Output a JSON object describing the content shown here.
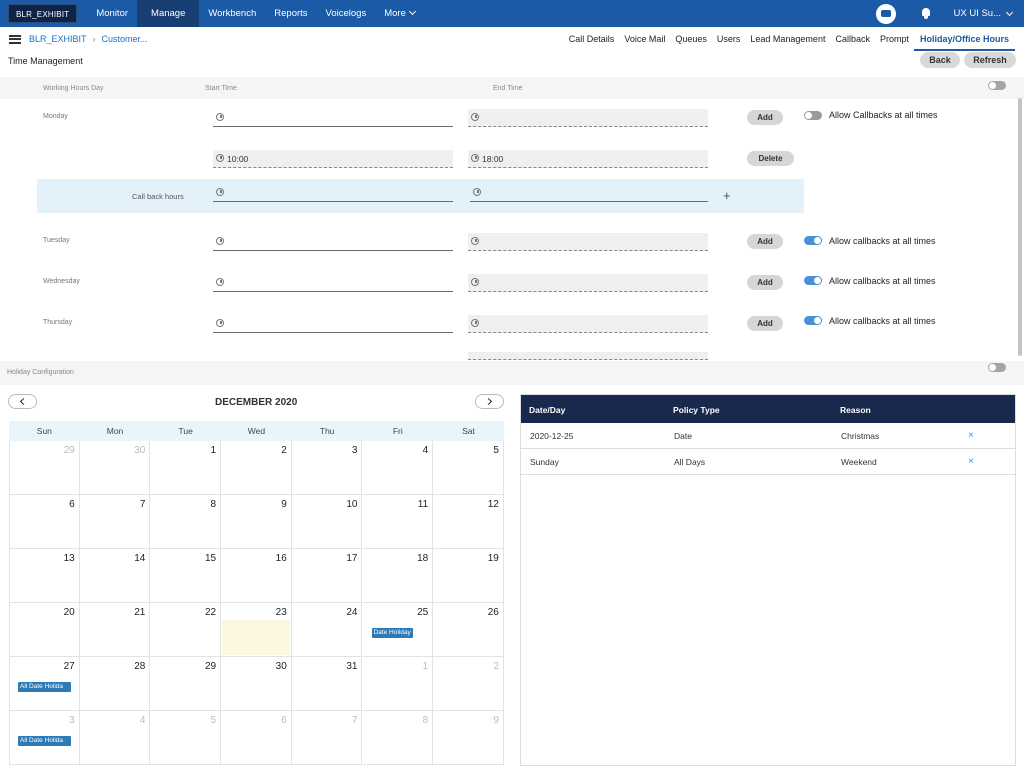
{
  "topnav": {
    "brand": "BLR_EXHIBIT",
    "items": [
      "Monitor",
      "Manage",
      "Workbench",
      "Reports",
      "Voicelogs",
      "More"
    ],
    "active": "Manage",
    "user": "UX UI Su...",
    "icons": [
      "chat-icon",
      "bell-icon",
      "chevron-down-icon"
    ]
  },
  "subnav": {
    "breadcrumb": [
      "BLR_EXHIBIT",
      "Customer..."
    ],
    "tabs": [
      "Call Details",
      "Voice Mail",
      "Queues",
      "Users",
      "Lead Management",
      "Callback",
      "Prompt",
      "Holiday/Office Hours"
    ],
    "active_tab": "Holiday/Office Hours"
  },
  "page": {
    "title": "Time Management",
    "back_label": "Back",
    "refresh_label": "Refresh"
  },
  "working_hours": {
    "headers": {
      "day": "Working Hours Day",
      "start": "Start Time",
      "end": "End Time"
    },
    "enabled": false,
    "monday": {
      "label": "Monday",
      "add_label": "Add",
      "allow_label": "Allow Callbacks at all times",
      "allow": false,
      "slot_start": "10:00",
      "slot_end": "18:00",
      "delete_label": "Delete",
      "callback_hours_label": "Call back hours"
    },
    "days": [
      {
        "label": "Tuesday",
        "add_label": "Add",
        "allow_label": "Allow callbacks at all times",
        "allow": true
      },
      {
        "label": "Wednesday",
        "add_label": "Add",
        "allow_label": "Allow callbacks at all times",
        "allow": true
      },
      {
        "label": "Thursday",
        "add_label": "Add",
        "allow_label": "Allow callbacks at all times",
        "allow": true
      }
    ]
  },
  "holiday": {
    "section_label": "Holiday Configuration",
    "enabled": false,
    "calendar": {
      "month_label": "DECEMBER 2020",
      "weekdays": [
        "Sun",
        "Mon",
        "Tue",
        "Wed",
        "Thu",
        "Fri",
        "Sat"
      ],
      "weeks": [
        [
          {
            "d": "29",
            "o": true
          },
          {
            "d": "30",
            "o": true
          },
          {
            "d": "1"
          },
          {
            "d": "2"
          },
          {
            "d": "3"
          },
          {
            "d": "4"
          },
          {
            "d": "5"
          }
        ],
        [
          {
            "d": "6"
          },
          {
            "d": "7"
          },
          {
            "d": "8"
          },
          {
            "d": "9"
          },
          {
            "d": "10"
          },
          {
            "d": "11"
          },
          {
            "d": "12"
          }
        ],
        [
          {
            "d": "13"
          },
          {
            "d": "14"
          },
          {
            "d": "15"
          },
          {
            "d": "16"
          },
          {
            "d": "17"
          },
          {
            "d": "18"
          },
          {
            "d": "19"
          }
        ],
        [
          {
            "d": "20"
          },
          {
            "d": "21"
          },
          {
            "d": "22"
          },
          {
            "d": "23",
            "today": true
          },
          {
            "d": "24"
          },
          {
            "d": "25",
            "event": "Date Holiday"
          },
          {
            "d": "26"
          }
        ],
        [
          {
            "d": "27",
            "event": "All Date Holida"
          },
          {
            "d": "28"
          },
          {
            "d": "29"
          },
          {
            "d": "30"
          },
          {
            "d": "31"
          },
          {
            "d": "1",
            "o": true
          },
          {
            "d": "2",
            "o": true
          }
        ],
        [
          {
            "d": "3",
            "o": true,
            "event": "All Date Holida"
          },
          {
            "d": "4",
            "o": true
          },
          {
            "d": "5",
            "o": true
          },
          {
            "d": "6",
            "o": true
          },
          {
            "d": "7",
            "o": true
          },
          {
            "d": "8",
            "o": true
          },
          {
            "d": "9",
            "o": true
          }
        ]
      ]
    },
    "table": {
      "columns": [
        "Date/Day",
        "Policy Type",
        "Reason"
      ],
      "rows": [
        [
          "2020-12-25",
          "Date",
          "Christmas"
        ],
        [
          "Sunday",
          "All Days",
          "Weekend"
        ]
      ],
      "delete_symbol": "×"
    }
  }
}
